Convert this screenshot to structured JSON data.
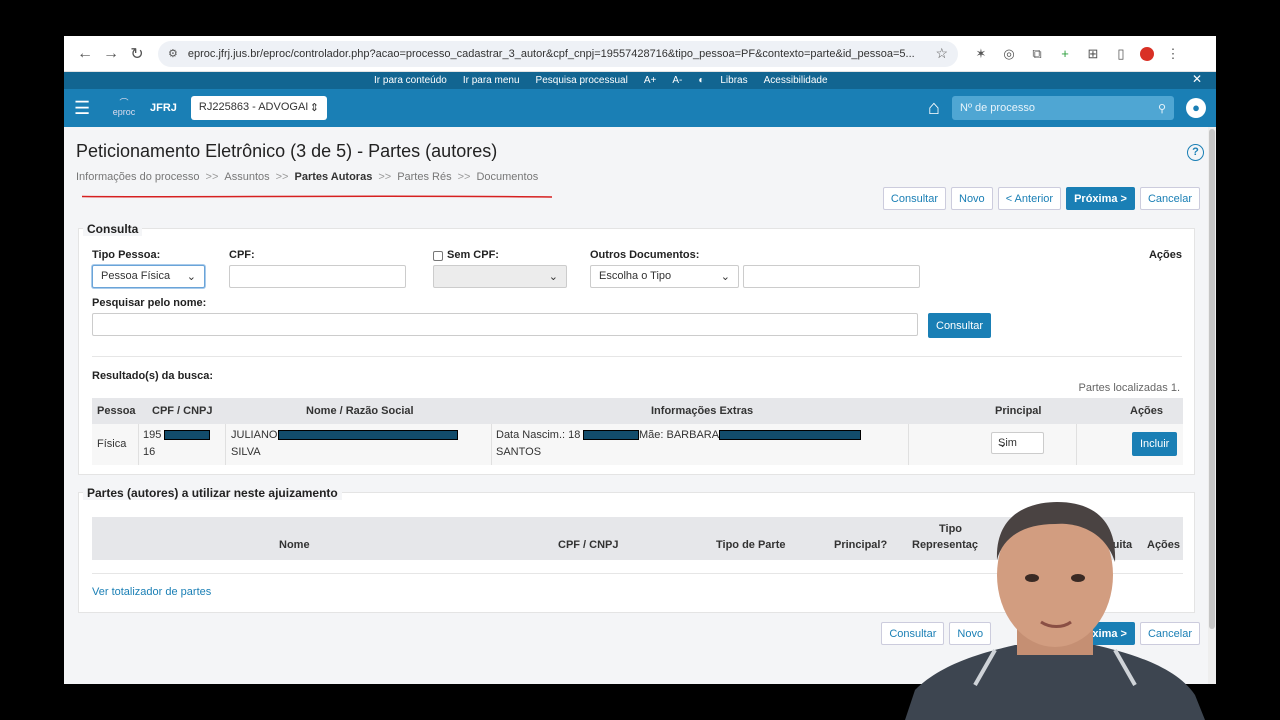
{
  "browser": {
    "url": "eproc.jfrj.jus.br/eproc/controlador.php?acao=processo_cadastrar_3_autor&cpf_cnpj=19557428716&tipo_pessoa=PF&contexto=parte&id_pessoa=5..."
  },
  "a11y": {
    "items": [
      "Ir para conteúdo",
      "Ir para menu",
      "Pesquisa processual",
      "A+",
      "A-",
      "◐",
      "Libras",
      "Acessibilidade"
    ]
  },
  "header": {
    "logo": "eproc",
    "org": "JFRJ",
    "role": "RJ225863 - ADVOGAI",
    "search_placeholder": "Nº de processo"
  },
  "page": {
    "title": "Peticionamento Eletrônico (3 de 5) - Partes (autores)",
    "breadcrumb": [
      "Informações do processo",
      "Assuntos",
      "Partes Autoras",
      "Partes Rés",
      "Documentos"
    ],
    "breadcrumb_sep": ">>",
    "buttons": [
      "Consultar",
      "Novo",
      "< Anterior",
      "Próxima >",
      "Cancelar"
    ]
  },
  "consulta": {
    "title": "Consulta",
    "tipo_pessoa_label": "Tipo Pessoa:",
    "tipo_pessoa_value": "Pessoa Física",
    "cpf_label": "CPF:",
    "sem_cpf_label": "Sem CPF:",
    "outros_doc_label": "Outros Documentos:",
    "outros_doc_value": "Escolha o Tipo",
    "acoes_label": "Ações",
    "pesquisar_label": "Pesquisar pelo nome:",
    "consultar_btn": "Consultar",
    "resultados_label": "Resultado(s) da busca:",
    "partes_localizadas": "Partes localizadas 1.",
    "columns": [
      "Pessoa",
      "CPF / CNPJ",
      "Nome / Razão Social",
      "Informações Extras",
      "Principal",
      "Ações"
    ],
    "row": {
      "pessoa": "Física",
      "cpf_1": "195",
      "cpf_2": "16",
      "nome_1": "JULIANO",
      "nome_2": "SILVA",
      "info_1": "Data Nascim.: 18",
      "info_mae": "Mãe: BARBARA",
      "info_2": "SANTOS",
      "principal": "Sim",
      "acao": "Incluir"
    }
  },
  "partes": {
    "title": "Partes (autores) a utilizar neste ajuizamento",
    "columns": [
      "Nome",
      "CPF / CNPJ",
      "Tipo de Parte",
      "Principal?",
      "Tipo",
      "Representaç",
      "Gratuita",
      "Ações"
    ],
    "totalizador_link": "Ver totalizador de partes"
  },
  "bottom_buttons": [
    "Consultar",
    "Novo",
    "Próxima >",
    "Cancelar"
  ],
  "colors": {
    "primary": "#1a7fb5",
    "header": "#126591",
    "annotation": "#d62020"
  }
}
